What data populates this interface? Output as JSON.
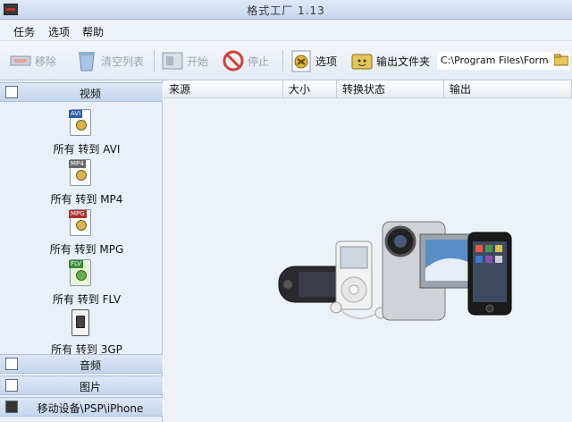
{
  "window": {
    "title": "格式工厂 1.13"
  },
  "menu": {
    "items": [
      "任务",
      "选项",
      "帮助"
    ]
  },
  "toolbar": {
    "remove": "移除",
    "clear_list": "清空列表",
    "start": "开始",
    "stop": "停止",
    "options": "选项",
    "output_folder": "输出文件夹",
    "output_path": "C:\\Program Files\\Form"
  },
  "sidebar": {
    "video_header": "视频",
    "video_items": [
      {
        "label": "所有 转到 AVI",
        "tag": "AVI",
        "tag_color": "#2a5fa8"
      },
      {
        "label": "所有 转到 MP4",
        "tag": "MP4",
        "tag_color": "#6a6a6a"
      },
      {
        "label": "所有 转到 MPG",
        "tag": "MPG",
        "tag_color": "#b03030"
      },
      {
        "label": "所有 转到 FLV",
        "tag": "FLV",
        "tag_color": "#3a8a3a"
      },
      {
        "label": "所有 转到 3GP",
        "tag": "",
        "tag_color": "#333333"
      }
    ],
    "audio_header": "音频",
    "image_header": "图片",
    "mobile_header": "移动设备\\PSP\\iPhone"
  },
  "table": {
    "columns": [
      "来源",
      "大小",
      "转换状态",
      "输出"
    ]
  }
}
